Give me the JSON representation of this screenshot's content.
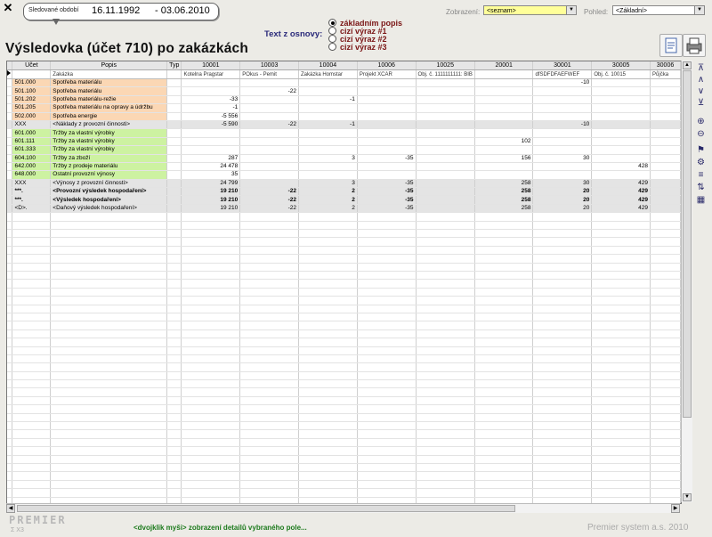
{
  "header": {
    "period_label": "Sledované období",
    "date_from": "16.11.1992",
    "date_to": "- 03.06.2010",
    "title": "Výsledovka (účet 710) po zakázkách",
    "osnova_label": "Text z osnovy:",
    "radio_options": [
      "základním popis",
      "cizí výraz #1",
      "cizí výraz #2",
      "cizí výraz #3"
    ],
    "radio_selected": 0,
    "zobrazeni_label": "Zobrazení:",
    "zobrazeni_value": "<seznam>",
    "pohled_label": "Pohled:",
    "pohled_value": "<Základní>",
    "close_glyph": "✕"
  },
  "grid": {
    "columns": [
      {
        "label": "Účet",
        "sub": ""
      },
      {
        "label": "Popis",
        "sub": "Zakázka"
      },
      {
        "label": "Typ",
        "sub": ""
      },
      {
        "label": "10001",
        "sub": "Kotelna Pragstar"
      },
      {
        "label": "10003",
        "sub": "POkus - Pemit"
      },
      {
        "label": "10004",
        "sub": "Zakázka Homstar"
      },
      {
        "label": "10006",
        "sub": "Projekt XCAR"
      },
      {
        "label": "10025",
        "sub": "Obj. č. 1111111111: BIB"
      },
      {
        "label": "20001",
        "sub": ""
      },
      {
        "label": "30001",
        "sub": "dfSDFDFAEFWEF"
      },
      {
        "label": "30005",
        "sub": "Obj. č. 10015"
      },
      {
        "label": "30006",
        "sub": "Půjčka"
      }
    ],
    "rows": [
      {
        "kind": "cost",
        "ucet": "501.000",
        "popis": "Spotřeba materiálu",
        "vals": [
          "",
          "",
          "",
          "",
          "",
          "",
          "-10",
          "",
          ""
        ]
      },
      {
        "kind": "cost",
        "ucet": "501.100",
        "popis": "Spotřeba materiálu",
        "vals": [
          "",
          "-22",
          "",
          "",
          "",
          "",
          "",
          "",
          ""
        ]
      },
      {
        "kind": "cost",
        "ucet": "501.202",
        "popis": "Spotřeba materiálu-režie",
        "vals": [
          "-33",
          "",
          "-1",
          "",
          "",
          "",
          "",
          "",
          ""
        ]
      },
      {
        "kind": "cost",
        "ucet": "501.205",
        "popis": "Spotřeba materiálu na opravy a údržbu",
        "vals": [
          "-1",
          "",
          "",
          "",
          "",
          "",
          "",
          "",
          ""
        ]
      },
      {
        "kind": "cost",
        "ucet": "502.000",
        "popis": "Spotřeba energie",
        "vals": [
          "-5 556",
          "",
          "",
          "",
          "",
          "",
          "",
          "",
          ""
        ]
      },
      {
        "kind": "sum",
        "ucet": "XXX",
        "popis": "<Náklady z provozní činnosti>",
        "vals": [
          "-5 590",
          "-22",
          "-1",
          "",
          "",
          "",
          "-10",
          "",
          ""
        ]
      },
      {
        "kind": "rev",
        "ucet": "601.000",
        "popis": "Tržby za vlastní výrobky",
        "vals": [
          "",
          "",
          "",
          "",
          "",
          "",
          "",
          "",
          ""
        ]
      },
      {
        "kind": "rev",
        "ucet": "601.111",
        "popis": "Tržby za vlastní výrobky",
        "vals": [
          "",
          "",
          "",
          "",
          "",
          "102",
          "",
          "",
          ""
        ]
      },
      {
        "kind": "rev",
        "ucet": "601.333",
        "popis": "Tržby za vlastní výrobky",
        "vals": [
          "",
          "",
          "",
          "",
          "",
          "",
          "",
          "",
          ""
        ]
      },
      {
        "kind": "rev",
        "ucet": "604.100",
        "popis": "Tržby za zboží",
        "vals": [
          "287",
          "",
          "3",
          "-35",
          "",
          "156",
          "30",
          "",
          ""
        ]
      },
      {
        "kind": "rev",
        "ucet": "642.000",
        "popis": "Tržby z prodeje materiálu",
        "vals": [
          "24 478",
          "",
          "",
          "",
          "",
          "",
          "",
          "428",
          ""
        ]
      },
      {
        "kind": "rev",
        "ucet": "648.000",
        "popis": "Ostatní provozní výnosy",
        "vals": [
          "35",
          "",
          "",
          "",
          "",
          "",
          "",
          "",
          ""
        ]
      },
      {
        "kind": "sum",
        "ucet": "XXX",
        "popis": "<Výnosy z provozní činnosti>",
        "vals": [
          "24 799",
          "",
          "3",
          "-35",
          "",
          "258",
          "30",
          "429",
          ""
        ]
      },
      {
        "kind": "sum bold",
        "ucet": "***.",
        "popis": "<Provozní výsledek hospodaření>",
        "vals": [
          "19 210",
          "-22",
          "2",
          "-35",
          "",
          "258",
          "20",
          "429",
          ""
        ]
      },
      {
        "kind": "sum bold",
        "ucet": "***.",
        "popis": "<Výsledek hospodaření>",
        "vals": [
          "19 210",
          "-22",
          "2",
          "-35",
          "",
          "258",
          "20",
          "429",
          ""
        ]
      },
      {
        "kind": "sum",
        "ucet": "<D>.",
        "popis": "<Daňový výsledek hospodaření>",
        "vals": [
          "19 210",
          "-22",
          "2",
          "-35",
          "",
          "258",
          "20",
          "429",
          ""
        ]
      }
    ]
  },
  "side_tools": [
    "⊼",
    "∧",
    "∨",
    "⊻",
    "⊕",
    "⊖",
    "⚑",
    "⚙",
    "≡",
    "⇅",
    "▦"
  ],
  "footer": {
    "hint": "<dvojklik myši> zobrazení detailů vybraného pole...",
    "copyright": "Premier system a.s.   2010",
    "logo": "PREMIER",
    "logo_sub": "Σ X3"
  }
}
